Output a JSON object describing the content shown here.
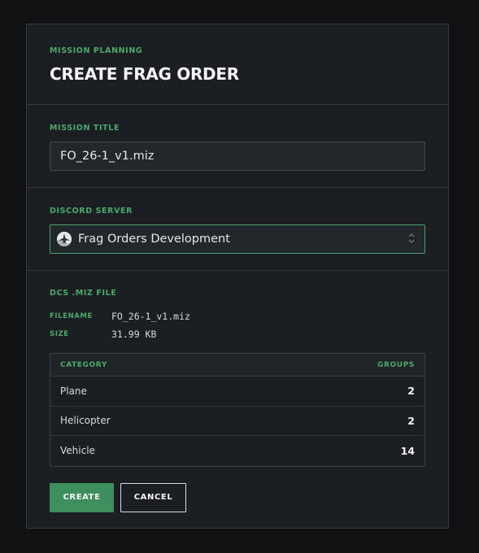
{
  "header": {
    "eyebrow": "MISSION PLANNING",
    "title": "CREATE FRAG ORDER"
  },
  "mission_title": {
    "label": "MISSION TITLE",
    "value": "FO_26-1_v1.miz"
  },
  "discord_server": {
    "label": "DISCORD SERVER",
    "selected": "Frag Orders Development",
    "icon": "server-avatar-icon"
  },
  "file": {
    "label": "DCS .MIZ FILE",
    "filename_key": "FILENAME",
    "filename_value": "FO_26-1_v1.miz",
    "size_key": "SIZE",
    "size_value": "31.99 KB"
  },
  "table": {
    "headers": [
      "CATEGORY",
      "GROUPS"
    ],
    "rows": [
      {
        "category": "Plane",
        "groups": "2"
      },
      {
        "category": "Helicopter",
        "groups": "2"
      },
      {
        "category": "Vehicle",
        "groups": "14"
      }
    ]
  },
  "actions": {
    "create": "CREATE",
    "cancel": "CANCEL"
  },
  "colors": {
    "accent": "#4ea86a",
    "primary_button": "#3f8e5e",
    "panel": "#1b1f23",
    "background": "#0f1112"
  }
}
